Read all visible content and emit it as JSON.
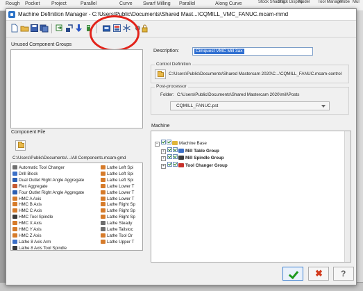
{
  "background_ribbon": {
    "items": [
      "Rough",
      "Pocket",
      "Project",
      "Parallel",
      "Curve",
      "Swarf Milling",
      "Parallel",
      "Along Curve",
      "Stock Shading",
      "Stock Display",
      "Model",
      "Tool Manager",
      "Probe",
      "Mul"
    ]
  },
  "window": {
    "title": "Machine Definition Manager - C:\\Users\\Public\\Documents\\Shared Mast...\\CQMILL_VMC_FANUC.mcam-mmd"
  },
  "toolbar": {
    "icons": [
      "new-file-icon",
      "open-file-icon",
      "save-icon",
      "save-as-icon",
      "import-icon",
      "export-icon",
      "arrow-down-icon",
      "control-definition-icon",
      "machine-icon",
      "highlighted-icon",
      "asterisk-icon",
      "settings-icon",
      "lock-icon"
    ]
  },
  "unused_groups": {
    "label": "Unused Component Groups"
  },
  "description": {
    "label": "Description:",
    "value": "Cimquest VMC Mill 3ax"
  },
  "control_definition": {
    "caption": "Control Definition",
    "path": "C:\\Users\\Public\\Documents\\Shared Mastercam 2020\\C...\\CQMILL_FANUC.mcam-control"
  },
  "post_processor": {
    "caption": "Post-processor",
    "folder_label": "Folder:",
    "folder_path": "C:\\Users\\Public\\Documents\\Shared Mastercam 2020\\mill\\Posts",
    "selected": "CQMILL_FANUC.pst"
  },
  "component_file": {
    "label": "Component File",
    "path": "C:\\Users\\Public\\Documents\\...\\All Components.mcam-gmd",
    "items_left": [
      {
        "label": "Automatic Tool Changer",
        "color": "#6e6e6e"
      },
      {
        "label": "Drill Block",
        "color": "#3b6fc7"
      },
      {
        "label": "Dual Outlet Right Angle Aggregate",
        "color": "#2b5fb3"
      },
      {
        "label": "Flex Aggregate",
        "color": "#c75a30"
      },
      {
        "label": "Four Outlet Right Angle Aggregate",
        "color": "#2b5fb3"
      },
      {
        "label": "HMC A Axis",
        "color": "#d67b2a"
      },
      {
        "label": "HMC B Axis",
        "color": "#d67b2a"
      },
      {
        "label": "HMC C Axis",
        "color": "#d67b2a"
      },
      {
        "label": "HMC Tool Spindle",
        "color": "#3a3a3a"
      },
      {
        "label": "HMC X Axis",
        "color": "#d67b2a"
      },
      {
        "label": "HMC Y Axis",
        "color": "#d67b2a"
      },
      {
        "label": "HMC Z Axis",
        "color": "#d67b2a"
      },
      {
        "label": "Lathe 8 Axis Arm",
        "color": "#3b6fc7"
      },
      {
        "label": "Lathe 8 Axis Tool Spindle",
        "color": "#3a3a3a"
      }
    ],
    "items_right": [
      {
        "label": "Lathe Left Spi",
        "color": "#d67b2a"
      },
      {
        "label": "Lathe Left Spi",
        "color": "#d67b2a"
      },
      {
        "label": "Lathe Left Spi",
        "color": "#d67b2a"
      },
      {
        "label": "Lathe Lower T",
        "color": "#d67b2a"
      },
      {
        "label": "Lathe Lower T",
        "color": "#d67b2a"
      },
      {
        "label": "Lathe Lower T",
        "color": "#d67b2a"
      },
      {
        "label": "Lathe Right Sp",
        "color": "#d67b2a"
      },
      {
        "label": "Lathe Right Sp",
        "color": "#d67b2a"
      },
      {
        "label": "Lathe Right Sp",
        "color": "#d67b2a"
      },
      {
        "label": "Lathe Steady",
        "color": "#6e6e6e"
      },
      {
        "label": "Lathe Tailstoc",
        "color": "#6e6e6e"
      },
      {
        "label": "Lathe Tool Or",
        "color": "#d67b2a"
      },
      {
        "label": "Lathe Upper T",
        "color": "#d67b2a"
      }
    ]
  },
  "machine": {
    "label": "Machine",
    "tree": [
      {
        "label": "Machine Base",
        "level": 0,
        "bold": false,
        "icon_color": "#e0b63c"
      },
      {
        "label": "Mill Table Group",
        "level": 1,
        "bold": true,
        "icon_color": "#3b6fc7"
      },
      {
        "label": "Mill Spindle Group",
        "level": 1,
        "bold": true,
        "icon_color": "#3a3a3a"
      },
      {
        "label": "Tool Changer Group",
        "level": 1,
        "bold": true,
        "icon_color": "#c7302a"
      }
    ]
  },
  "buttons": {
    "ok": "ok-check-icon",
    "cancel": "cancel-x-icon",
    "help": "help-icon"
  },
  "colors": {
    "highlight_circle": "#e2231a",
    "selection": "#2f6fd1"
  }
}
